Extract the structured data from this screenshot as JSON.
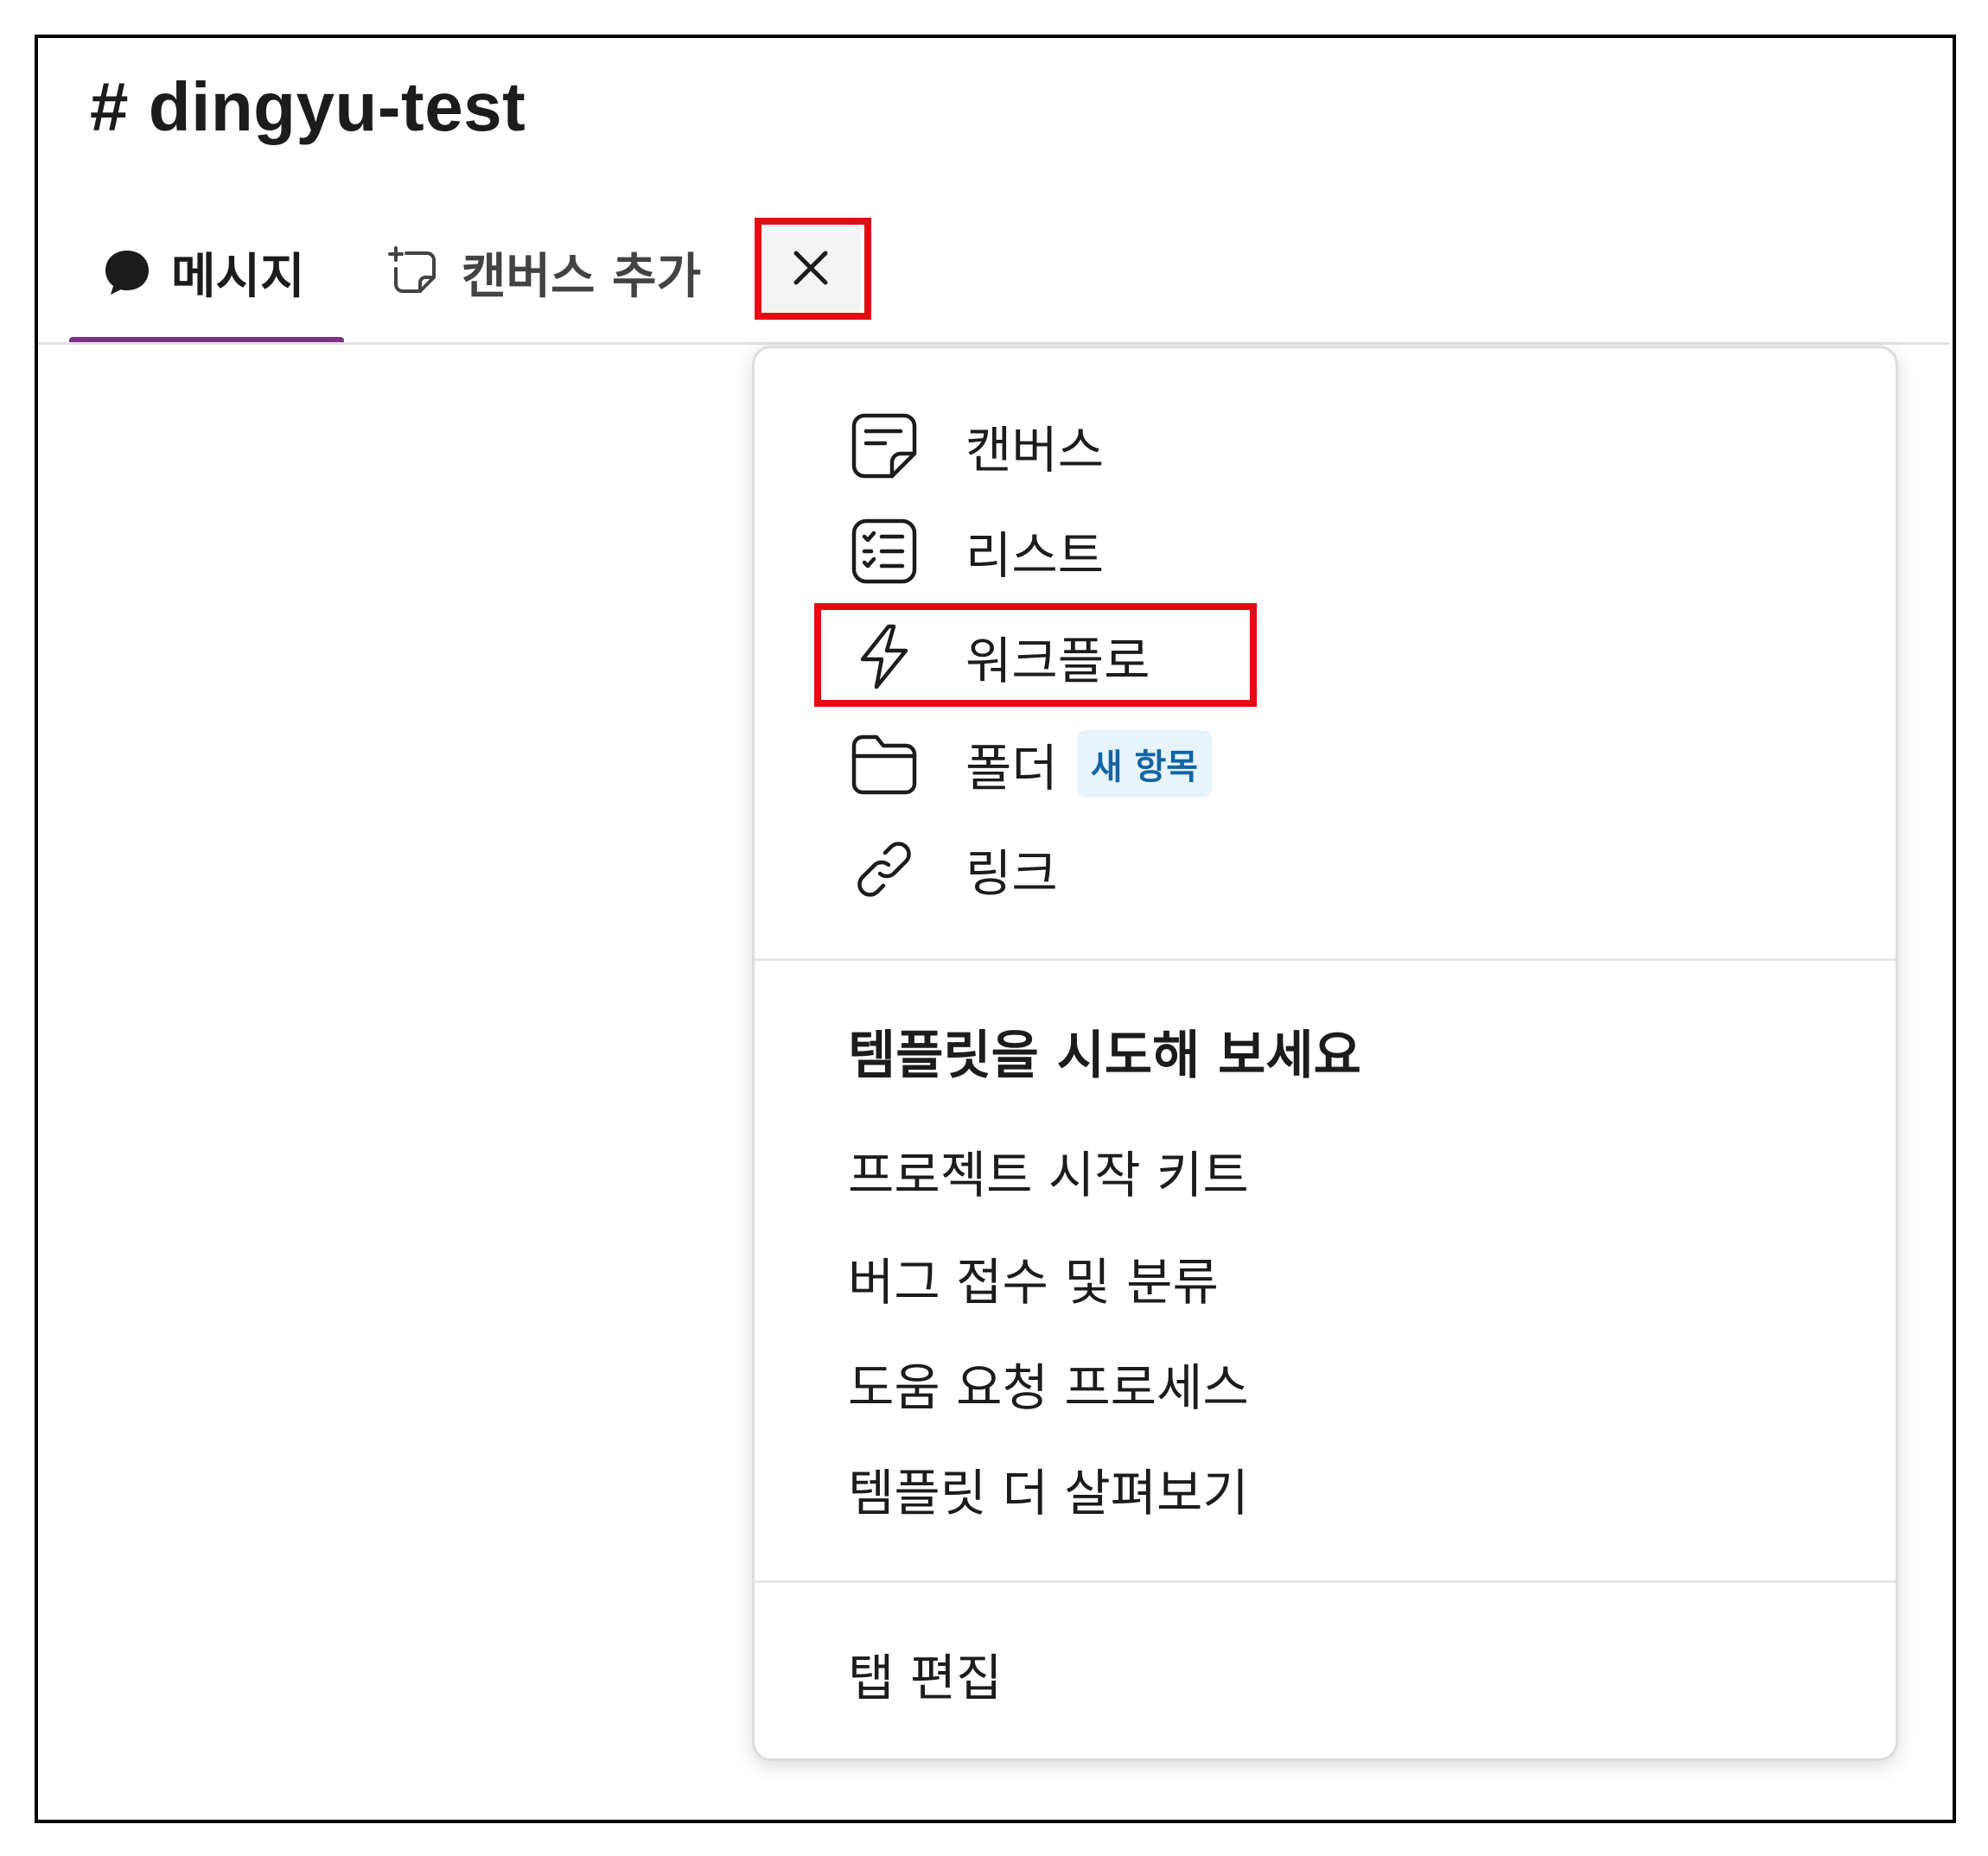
{
  "channel": {
    "title": "# dingyu-test"
  },
  "tabs": [
    {
      "label": "메시지",
      "icon": "message-bubble-icon",
      "active": true
    },
    {
      "label": "캔버스 추가",
      "icon": "add-canvas-icon",
      "active": false
    }
  ],
  "close_button": {
    "icon": "close-icon",
    "glyph": "✕"
  },
  "menu": {
    "items": [
      {
        "label": "캔버스",
        "icon": "canvas-icon"
      },
      {
        "label": "리스트",
        "icon": "list-icon"
      },
      {
        "label": "워크플로",
        "icon": "lightning-icon"
      },
      {
        "label": "폴더",
        "icon": "folder-icon",
        "badge": "새 항목"
      },
      {
        "label": "링크",
        "icon": "link-icon"
      }
    ],
    "templates_heading": "템플릿을 시도해 보세요",
    "templates": [
      "프로젝트 시작 키트",
      "버그 접수 및 분류",
      "도움 요청 프로세스",
      "템플릿 더 살펴보기"
    ],
    "edit_tabs": "탭 편집"
  },
  "colors": {
    "accent_underline": "#7c3085",
    "highlight_box": "#e50914",
    "badge_bg": "#e7f4fb",
    "badge_text": "#1264a3"
  }
}
